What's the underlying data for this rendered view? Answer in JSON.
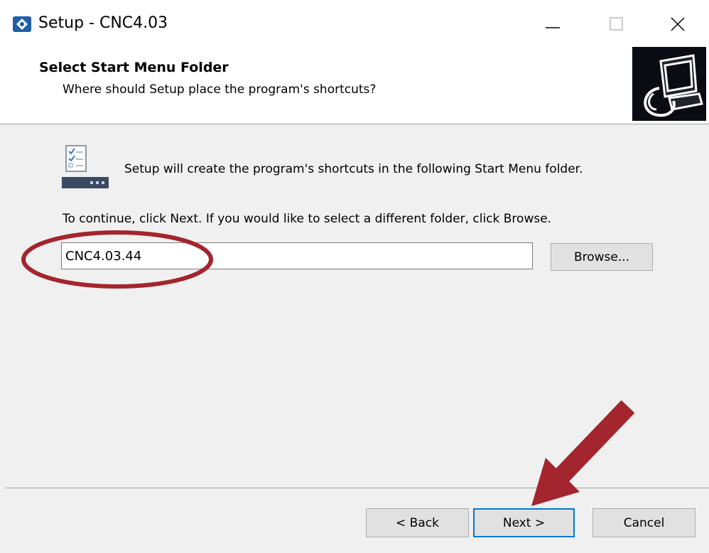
{
  "window": {
    "title": "Setup - CNC4.03",
    "app_icon": "setup-app-icon",
    "controls": [
      "minimize-icon",
      "maximize-icon",
      "close-icon"
    ]
  },
  "header": {
    "title": "Select Start Menu Folder",
    "subtitle": "Where should Setup place the program's shortcuts?",
    "image": "setup-computer-icon"
  },
  "main": {
    "intro_text": "Setup will create the program's shortcuts in the following Start Menu folder.",
    "instruction_text": "To continue, click Next. If you would like to select a different folder, click Browse.",
    "folder_value": "CNC4.03.44",
    "browse_label": "Browse..."
  },
  "footer": {
    "back_label": "< Back",
    "next_label": "Next >",
    "cancel_label": "Cancel"
  },
  "annotations": {
    "highlight_color": "#a3252d",
    "items": [
      "ellipse-highlight on folder field",
      "arrow pointing to Next button"
    ]
  }
}
